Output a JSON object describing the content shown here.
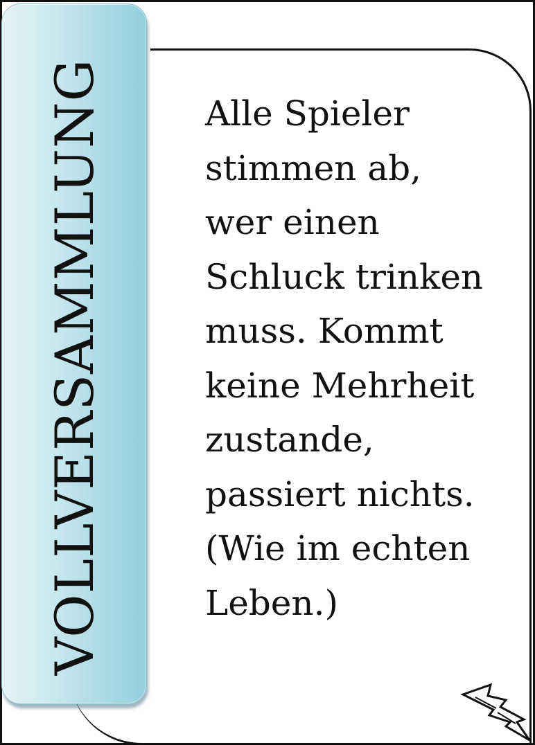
{
  "card": {
    "title": "VOLLVERSAMMLUNG",
    "rule_lines": [
      "Alle Spieler",
      "stimmen ab,",
      "wer einen",
      "Schluck trinken",
      "muss. Kommt",
      "keine Mehrheit",
      "zustande,",
      "passiert nichts.",
      "(Wie im echten",
      "Leben.)"
    ],
    "corner_icon": "lightning-bolt-icon",
    "colors": {
      "banner_light": "#e6f4f8",
      "banner_dark": "#93cfdc",
      "border": "#111111",
      "background": "#ffffff"
    }
  }
}
